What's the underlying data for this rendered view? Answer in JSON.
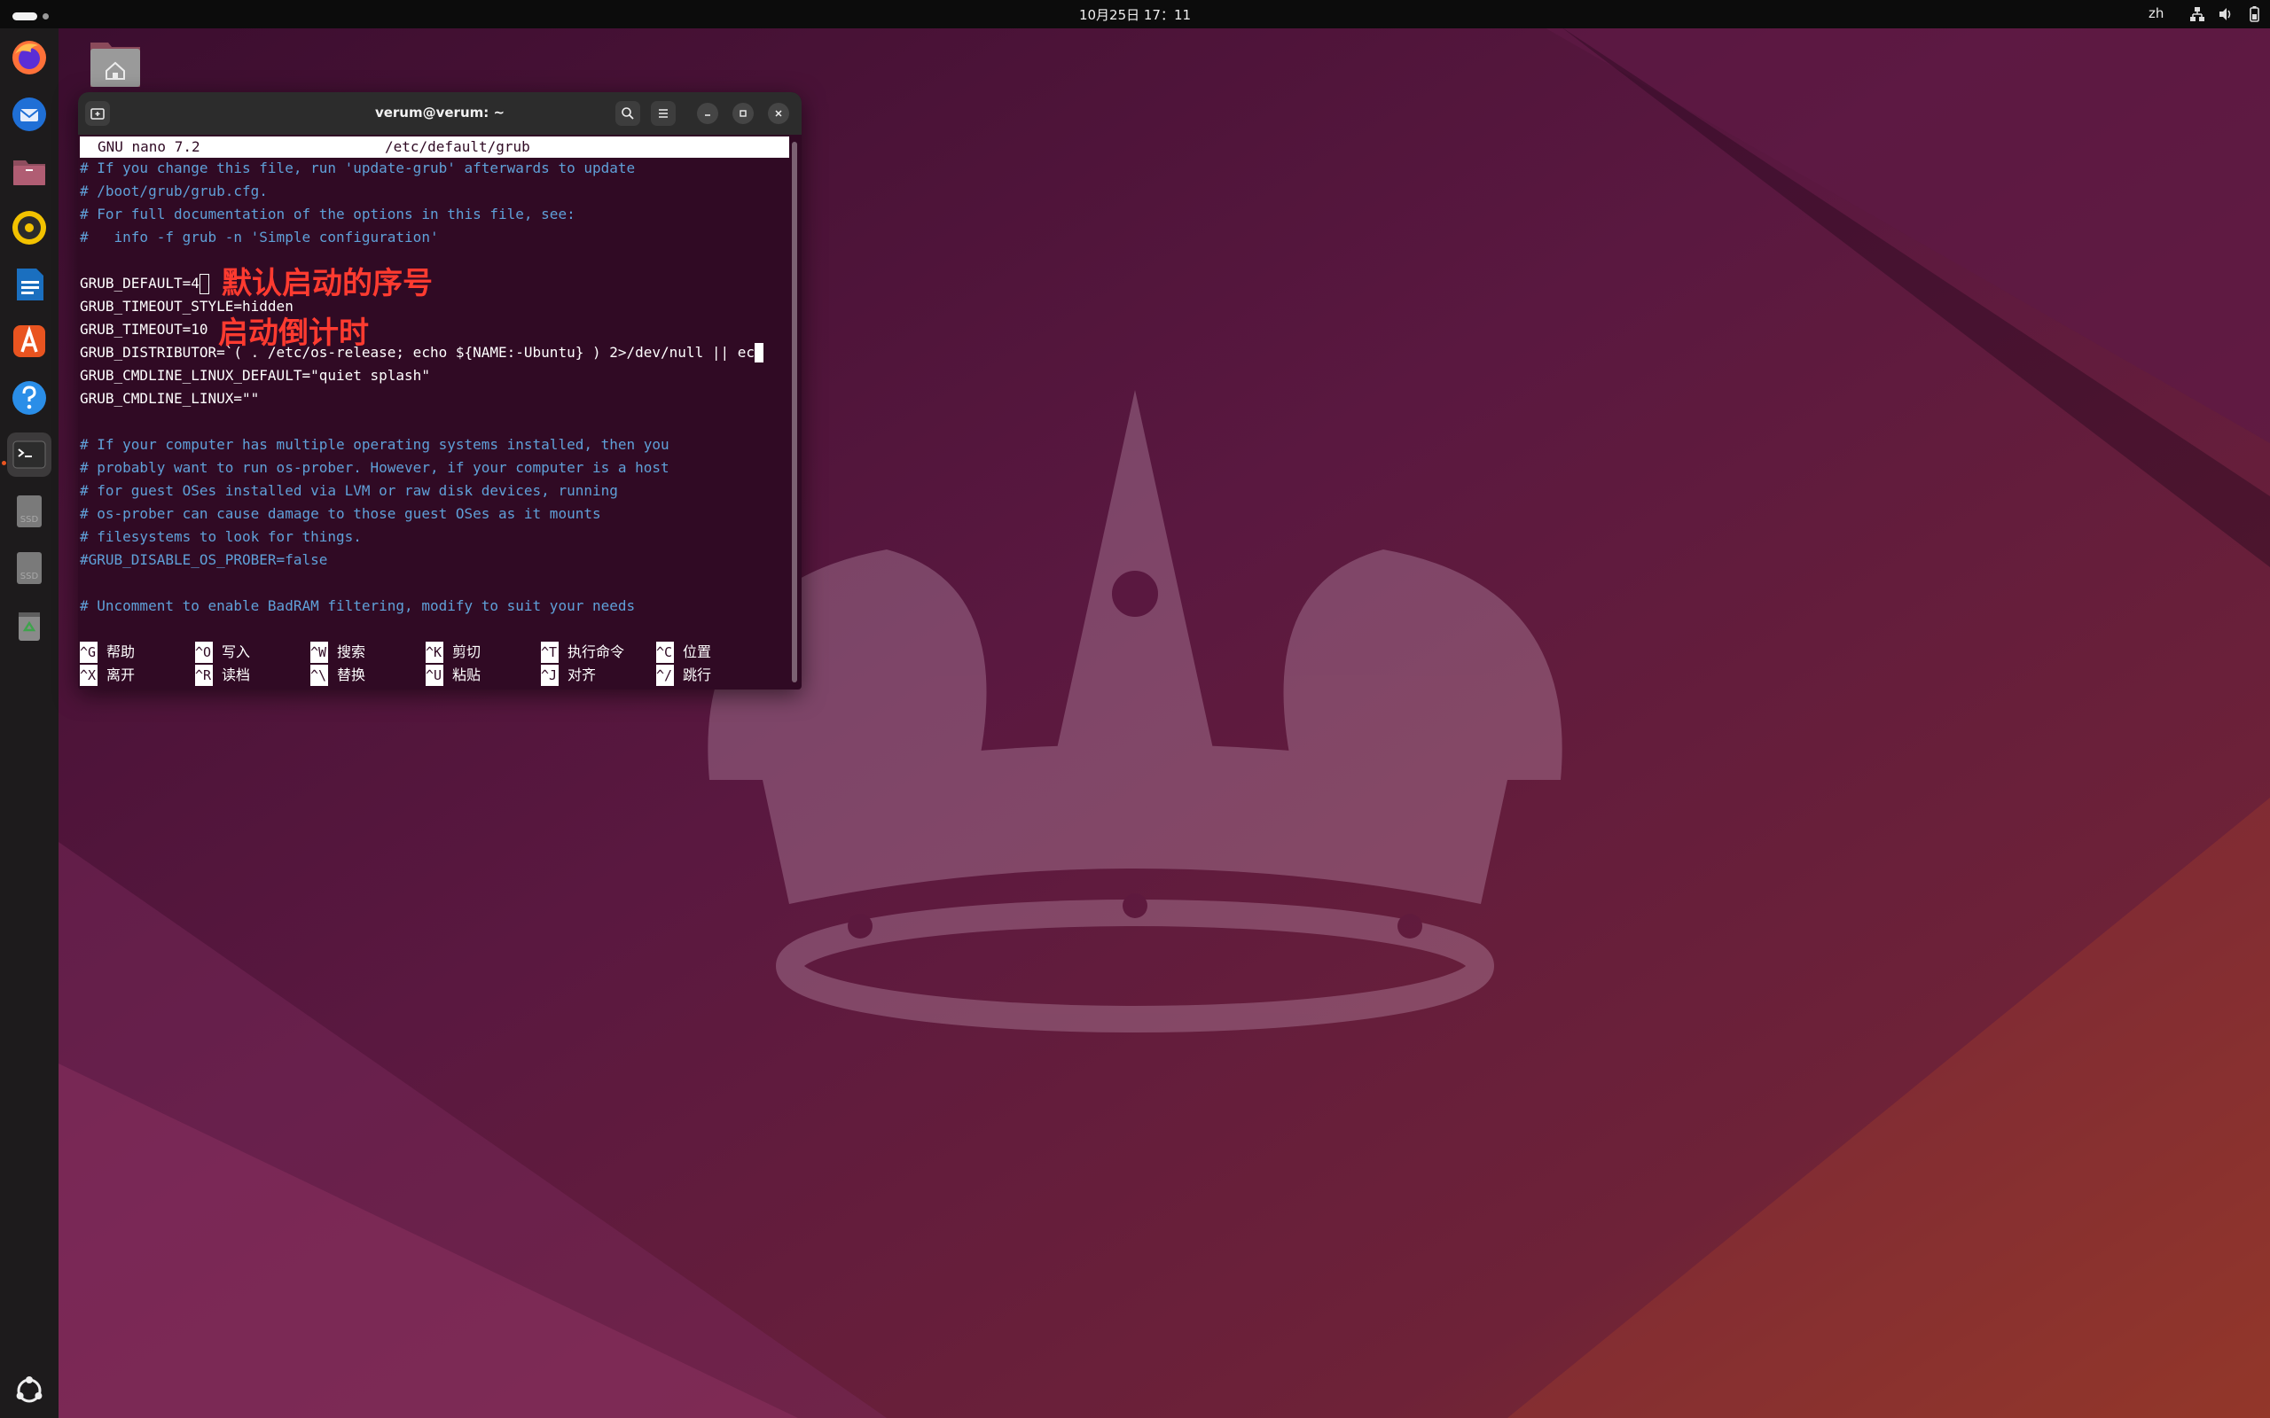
{
  "topbar": {
    "clock": "10月25日 17：11",
    "language": "zh"
  },
  "dock": {
    "items": [
      {
        "name": "firefox",
        "icon": "firefox-icon"
      },
      {
        "name": "thunderbird",
        "icon": "thunderbird-icon"
      },
      {
        "name": "files",
        "icon": "files-icon"
      },
      {
        "name": "rhythmbox",
        "icon": "rhythmbox-icon"
      },
      {
        "name": "libreoffice-writer",
        "icon": "writer-icon"
      },
      {
        "name": "app-center",
        "icon": "app-center-icon"
      },
      {
        "name": "help",
        "icon": "help-icon"
      },
      {
        "name": "terminal",
        "icon": "terminal-icon",
        "running": true
      },
      {
        "name": "ssd-drive-1",
        "label": "SSD",
        "icon": "drive-icon"
      },
      {
        "name": "ssd-drive-2",
        "label": "SSD",
        "icon": "drive-icon"
      },
      {
        "name": "trash",
        "icon": "trash-icon"
      },
      {
        "name": "show-apps",
        "icon": "ubuntu-apps-icon"
      }
    ]
  },
  "desktop": {
    "home_icon": "home-folder-icon"
  },
  "terminal": {
    "title": "verum@verum: ~",
    "nano": {
      "version": "GNU nano 7.2",
      "filename": "/etc/default/grub"
    },
    "lines": {
      "l1": "# If you change this file, run 'update-grub' afterwards to update",
      "l2": "# /boot/grub/grub.cfg.",
      "l3": "# For full documentation of the options in this file, see:",
      "l4": "#   info -f grub -n 'Simple configuration'",
      "l6": "GRUB_DEFAULT=4",
      "l7": "GRUB_TIMEOUT_STYLE=hidden",
      "l8": "GRUB_TIMEOUT=10",
      "l9": "GRUB_DISTRIBUTOR=`( . /etc/os-release; echo ${NAME:-Ubuntu} ) 2>/dev/null || ec",
      "l10": "GRUB_CMDLINE_LINUX_DEFAULT=\"quiet splash\"",
      "l11": "GRUB_CMDLINE_LINUX=\"\"",
      "l13": "# If your computer has multiple operating systems installed, then you",
      "l14": "# probably want to run os-prober. However, if your computer is a host",
      "l15": "# for guest OSes installed via LVM or raw disk devices, running",
      "l16": "# os-prober can cause damage to those guest OSes as it mounts",
      "l17": "# filesystems to look for things.",
      "l18": "#GRUB_DISABLE_OS_PROBER=false",
      "l20": "# Uncomment to enable BadRAM filtering, modify to suit your needs"
    },
    "annotations": {
      "default_entry": "默认启动的序号",
      "timeout": "启动倒计时"
    },
    "shortcuts": [
      {
        "key": "^G",
        "label": "帮助"
      },
      {
        "key": "^O",
        "label": "写入"
      },
      {
        "key": "^W",
        "label": "搜索"
      },
      {
        "key": "^K",
        "label": "剪切"
      },
      {
        "key": "^T",
        "label": "执行命令"
      },
      {
        "key": "^C",
        "label": "位置"
      },
      {
        "key": "^X",
        "label": "离开"
      },
      {
        "key": "^R",
        "label": "读档"
      },
      {
        "key": "^\\",
        "label": "替换"
      },
      {
        "key": "^U",
        "label": "粘贴"
      },
      {
        "key": "^J",
        "label": "对齐"
      },
      {
        "key": "^/",
        "label": "跳行"
      }
    ]
  },
  "colors": {
    "accent": "#e95420",
    "terminal_bg": "#300a24",
    "comment": "#5fa0d8",
    "annotation": "#ff3b30"
  }
}
